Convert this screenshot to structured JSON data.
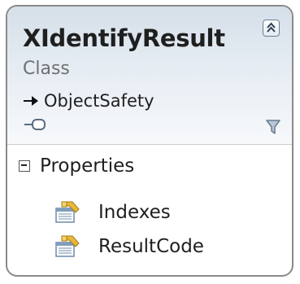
{
  "shape": {
    "title": "XIdentifyResult",
    "kind": "Class",
    "base": "ObjectSafety"
  },
  "compartment": {
    "label": "Properties",
    "members": [
      "Indexes",
      "ResultCode"
    ]
  },
  "icons": {
    "collapse": "collapse-chevrons-icon",
    "inheritance": "inheritance-arrow-icon",
    "interface": "lollipop-interface-icon",
    "filter": "filter-funnel-icon",
    "compartment_toggle": "minus-toggle-icon",
    "property": "property-icon"
  },
  "colors": {
    "header_gradient_top": "#d5dfe9",
    "border": "#8a8a8a",
    "subtitle": "#707070"
  }
}
